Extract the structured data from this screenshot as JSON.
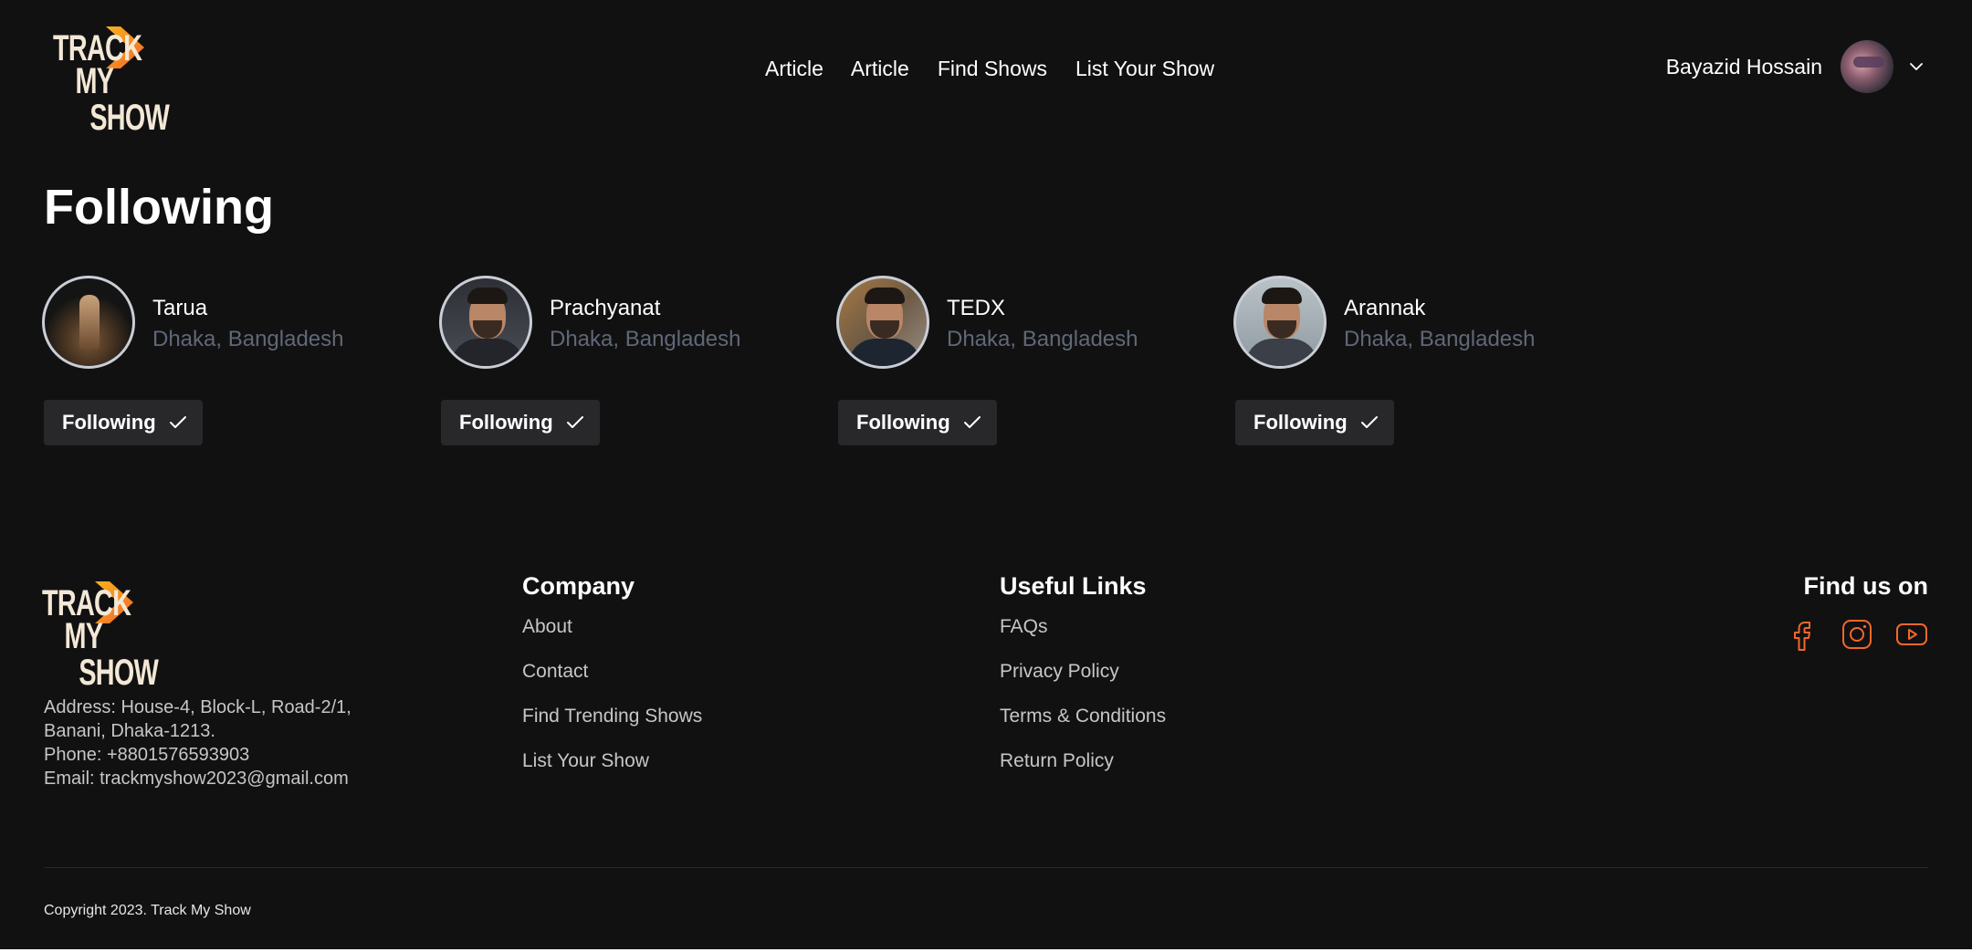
{
  "header": {
    "logo": {
      "line1": "TRACK",
      "line2": "MY",
      "line3": "SHOW"
    },
    "nav": [
      "Article",
      "Article",
      "Find Shows",
      "List Your Show"
    ],
    "user": {
      "name": "Bayazid Hossain"
    }
  },
  "main": {
    "title": "Following",
    "following": [
      {
        "name": "Tarua",
        "location": "Dhaka, Bangladesh",
        "button": "Following"
      },
      {
        "name": "Prachyanat",
        "location": "Dhaka, Bangladesh",
        "button": "Following"
      },
      {
        "name": "TEDX",
        "location": "Dhaka, Bangladesh",
        "button": "Following"
      },
      {
        "name": "Arannak",
        "location": "Dhaka, Bangladesh",
        "button": "Following"
      }
    ]
  },
  "footer": {
    "address": {
      "line1": "Address: House-4, Block-L, Road-2/1,",
      "line2": "Banani, Dhaka-1213.",
      "phone": "Phone:  +8801576593903",
      "email": "Email:  trackmyshow2023@gmail.com"
    },
    "company": {
      "title": "Company",
      "links": [
        "About",
        "Contact",
        "Find Trending Shows",
        "List Your Show"
      ]
    },
    "useful_links": {
      "title": "Useful Links",
      "links": [
        "FAQs",
        "Privacy Policy",
        "Terms & Conditions",
        "Return Policy"
      ]
    },
    "social": {
      "title": "Find us on",
      "icons": [
        "facebook-icon",
        "instagram-icon",
        "youtube-icon"
      ]
    },
    "copyright": "Copyright 2023. Track My Show"
  },
  "colors": {
    "background": "#121112",
    "accent": "#f2672a",
    "logo_orange": "#f7a51b",
    "muted_text": "#5f6877",
    "button_bg": "#28272a"
  }
}
